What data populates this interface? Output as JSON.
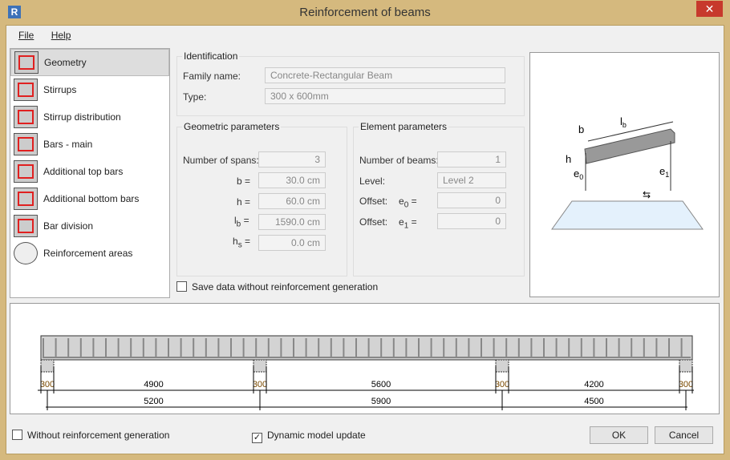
{
  "window": {
    "title": "Reinforcement of beams",
    "logo": "R",
    "close": "✕"
  },
  "menu": [
    "File",
    "Help"
  ],
  "sidebar": {
    "items": [
      {
        "label": "Geometry",
        "icon": "geometry-icon",
        "selected": true
      },
      {
        "label": "Stirrups",
        "icon": "stirrups-icon"
      },
      {
        "label": "Stirrup distribution",
        "icon": "stirrup-distribution-icon"
      },
      {
        "label": "Bars - main",
        "icon": "main-bars-icon"
      },
      {
        "label": "Additional top bars",
        "icon": "top-bars-icon"
      },
      {
        "label": "Additional bottom bars",
        "icon": "bottom-bars-icon"
      },
      {
        "label": "Bar division",
        "icon": "bar-division-icon"
      },
      {
        "label": "Reinforcement areas",
        "icon": "reinforcement-areas-icon"
      }
    ]
  },
  "identification": {
    "legend": "Identification",
    "family_label": "Family name:",
    "family": "Concrete-Rectangular Beam",
    "type_label": "Type:",
    "type": "300 x 600mm"
  },
  "geometric": {
    "legend": "Geometric parameters",
    "spans_label": "Number of spans:",
    "spans": "3",
    "b_label": "b =",
    "b": "30.0 cm",
    "h_label": "h =",
    "h": "60.0 cm",
    "lb_label": "l",
    "lb_sub": "b",
    "lb_eq": "=",
    "lb": "1590.0 cm",
    "hs_label": "h",
    "hs_sub": "s",
    "hs_eq": "=",
    "hs": "0.0 cm"
  },
  "element": {
    "legend": "Element parameters",
    "beams_label": "Number of beams:",
    "beams": "1",
    "level_label": "Level:",
    "level": "Level 2",
    "offset0_label": "Offset:",
    "e0": "e",
    "e0_sub": "0",
    "e0_eq": "=",
    "offset0": "0",
    "offset1_label": "Offset:",
    "e1": "e",
    "e1_sub": "1",
    "e1_eq": "=",
    "offset1": "0"
  },
  "diagram_labels": {
    "lb": "l",
    "lb_sub": "b",
    "b": "b",
    "h": "h",
    "e0": "e",
    "e0_sub": "0",
    "e1": "e",
    "e1_sub": "1"
  },
  "save_without": {
    "label": "Save data without reinforcement generation",
    "checked": false
  },
  "beam": {
    "supports": [
      "300",
      "300",
      "300",
      "300"
    ],
    "clear_spans": [
      "4900",
      "5600",
      "4200"
    ],
    "axis_spans": [
      "5200",
      "5900",
      "4500"
    ]
  },
  "footer": {
    "without_label": "Without reinforcement generation",
    "without_checked": false,
    "dynamic_label": "Dynamic model update",
    "dynamic_checked": true,
    "ok": "OK",
    "cancel": "Cancel"
  }
}
